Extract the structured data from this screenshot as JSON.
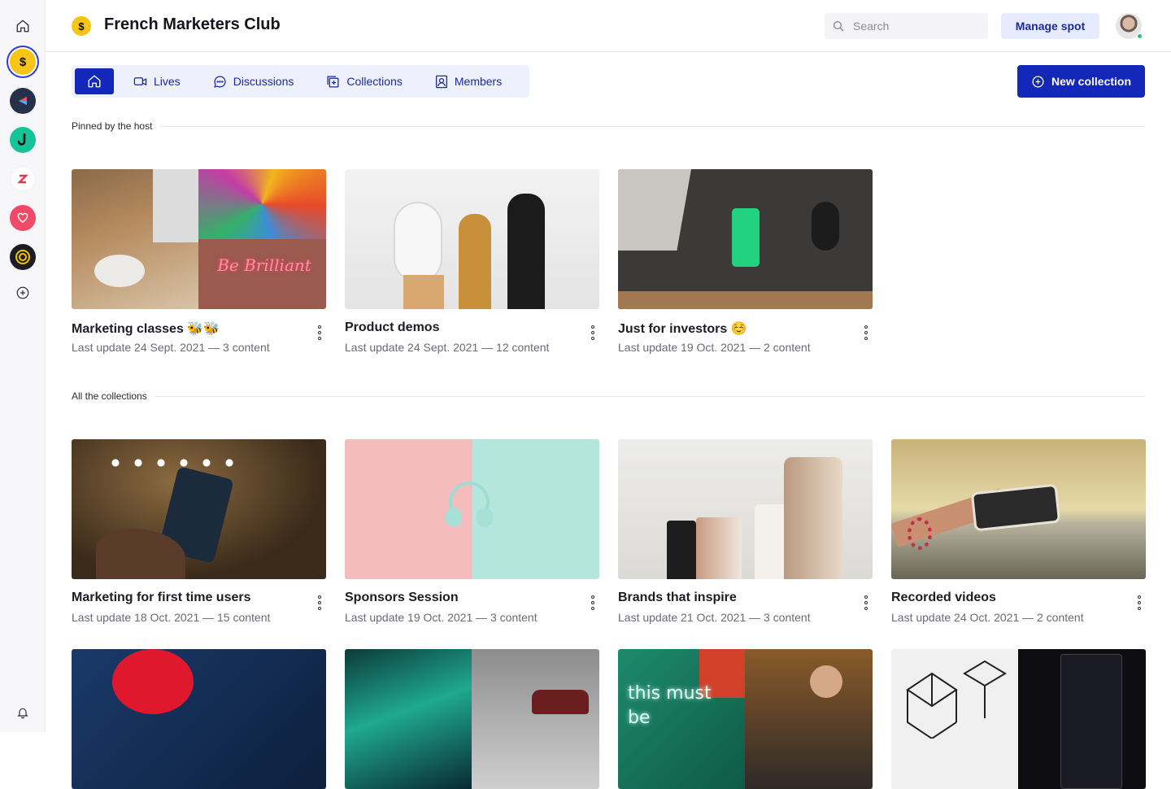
{
  "header": {
    "title": "French Marketers Club",
    "search_placeholder": "Search",
    "manage_label": "Manage spot"
  },
  "tabs": [
    {
      "label": "Lives"
    },
    {
      "label": "Discussions"
    },
    {
      "label": "Collections"
    },
    {
      "label": "Members"
    }
  ],
  "new_collection_label": "New collection",
  "sections": {
    "pinned": "Pinned by the host",
    "all": "All the collections"
  },
  "pinned_cards": [
    {
      "title": "Marketing classes 🐝🐝",
      "meta": "Last update 24 Sept. 2021 —  3 content"
    },
    {
      "title": "Product demos",
      "meta": "Last update 24 Sept. 2021 —  12 content"
    },
    {
      "title": "Just for investors ☺️",
      "meta": "Last update 19 Oct. 2021  —  2 content"
    }
  ],
  "all_cards": [
    {
      "title": "Marketing for first time users",
      "meta": "Last update 18 Oct. 2021 — 15 content"
    },
    {
      "title": "Sponsors Session",
      "meta": "Last update 19 Oct. 2021 — 3 content"
    },
    {
      "title": "Brands that inspire",
      "meta": "Last update 21 Oct. 2021 — 3 content"
    },
    {
      "title": "Recorded videos",
      "meta": "Last update 24 Oct. 2021 — 2 content"
    }
  ],
  "thumb_texts": {
    "neon": "Be Brilliant",
    "this_must_be": "this must be"
  },
  "colors": {
    "primary": "#1327b8",
    "tab_bg": "#eef1fb",
    "club_yellow": "#f5c518"
  }
}
